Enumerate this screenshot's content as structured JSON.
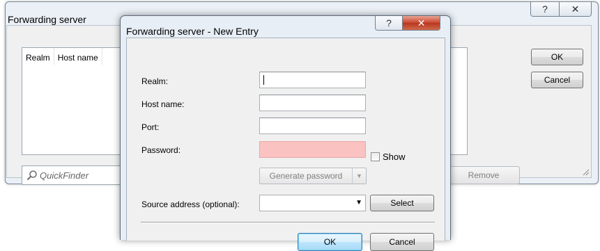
{
  "parent_dialog": {
    "title": "Forwarding server",
    "help_icon": "help-icon",
    "close_icon": "close-icon",
    "columns": [
      "Realm",
      "Host name"
    ],
    "quickfinder_placeholder": "QuickFinder",
    "remove_label": "Remove",
    "ok_label": "OK",
    "cancel_label": "Cancel"
  },
  "child_dialog": {
    "title": "Forwarding server - New Entry",
    "help_icon": "help-icon",
    "close_icon": "close-icon",
    "fields": {
      "realm_label": "Realm:",
      "realm_value": "",
      "host_label": "Host name:",
      "host_value": "",
      "port_label": "Port:",
      "port_value": "",
      "password_label": "Password:",
      "password_value": "",
      "show_label": "Show",
      "show_checked": false,
      "generate_label": "Generate password",
      "source_label": "Source address (optional):",
      "source_value": "",
      "select_label": "Select"
    },
    "ok_label": "OK",
    "cancel_label": "Cancel"
  },
  "colors": {
    "password_invalid_bg": "#fbc2c2",
    "default_button_blue": "#a7d9f5",
    "close_button_red": "#c9442b"
  }
}
